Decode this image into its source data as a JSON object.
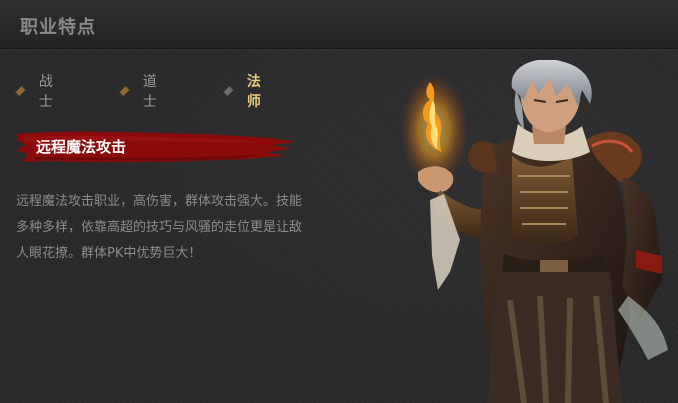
{
  "header": {
    "title": "职业特点"
  },
  "tabs": [
    {
      "label": "战士",
      "active": false
    },
    {
      "label": "道士",
      "active": false
    },
    {
      "label": "法师",
      "active": true
    }
  ],
  "content": {
    "subtitle": "远程魔法攻击",
    "description": "远程魔法攻击职业，高伤害，群体攻击强大。技能多种多样，依靠高超的技巧与风骚的走位更是让敌人眼花撩。群体PK中优势巨大！"
  },
  "colors": {
    "active_tab": "#e6c97e",
    "inactive_tab": "#9a9a9a",
    "brush_red": "#8b0b0b",
    "background": "#29292b"
  },
  "icons": [
    "diamond-bullet-icon",
    "flame-icon"
  ]
}
